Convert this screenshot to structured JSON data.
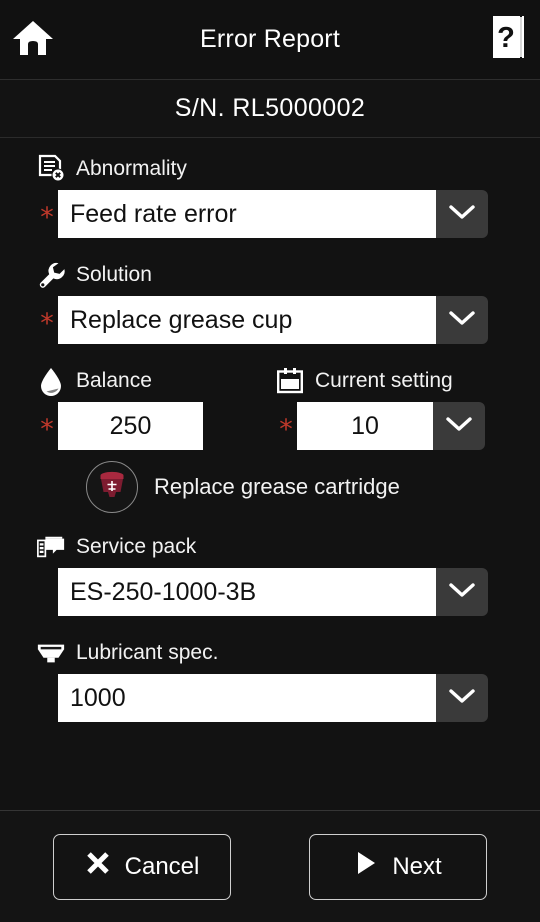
{
  "titlebar": {
    "title": "Error Report",
    "home_icon": "home-icon",
    "help_icon": "help-book-icon"
  },
  "serial": {
    "text": "S/N.  RL5000002"
  },
  "form": {
    "required_marker": "*",
    "fields": [
      {
        "key": "abnormality",
        "label": "Abnormality",
        "icon": "document-error-icon",
        "value": "Feed rate error",
        "required": true,
        "has_dropdown": true
      },
      {
        "key": "solution",
        "label": "Solution",
        "icon": "wrench-icon",
        "value": "Replace grease cup",
        "required": true,
        "has_dropdown": true
      },
      {
        "key": "balance",
        "label": "Balance",
        "icon": "droplet-icon",
        "value": "250",
        "required": true,
        "has_dropdown": false
      },
      {
        "key": "current_setting",
        "label": "Current setting",
        "icon": "calendar-icon",
        "value": "10",
        "required": true,
        "has_dropdown": true
      },
      {
        "key": "service_pack",
        "label": "Service pack",
        "icon": "package-icon",
        "value": "ES-250-1000-3B",
        "required": false,
        "has_dropdown": true
      },
      {
        "key": "lubricant_spec",
        "label": "Lubricant spec.",
        "icon": "grease-cup-icon",
        "value": "1000",
        "required": false,
        "has_dropdown": true
      }
    ],
    "cartridge_action": {
      "label": "Replace grease cartridge",
      "icon": "grease-cartridge-icon"
    }
  },
  "bottombar": {
    "cancel_label": "Cancel",
    "cancel_icon": "close-x-icon",
    "next_label": "Next",
    "next_icon": "play-triangle-icon"
  },
  "colors": {
    "background": "#121212",
    "titlebar": "#111111",
    "field_background": "#ffffff",
    "field_text": "#111111",
    "dropdown_button": "#3a3a3a",
    "required_star": "#c0392b",
    "cartridge_red": "#8e1f35",
    "text": "#f2f2f2",
    "button_border": "#cfcfcf"
  }
}
